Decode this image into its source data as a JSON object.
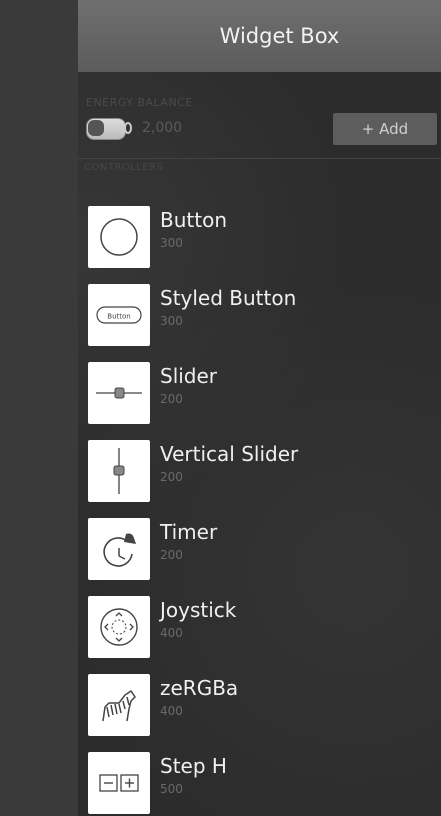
{
  "header": {
    "title": "Widget Box"
  },
  "energy": {
    "caption": "ENERGY BALANCE",
    "amount": "2,000",
    "add_label": "+ Add"
  },
  "widgets_caption": "CONTROLLERS",
  "items": [
    {
      "name": "Button",
      "price": "300",
      "icon": "circle-icon"
    },
    {
      "name": "Styled Button",
      "price": "300",
      "icon": "styled-button-icon"
    },
    {
      "name": "Slider",
      "price": "200",
      "icon": "slider-icon"
    },
    {
      "name": "Vertical Slider",
      "price": "200",
      "icon": "vertical-slider-icon"
    },
    {
      "name": "Timer",
      "price": "200",
      "icon": "timer-icon"
    },
    {
      "name": "Joystick",
      "price": "400",
      "icon": "joystick-icon"
    },
    {
      "name": "zeRGBa",
      "price": "400",
      "icon": "zebra-icon"
    },
    {
      "name": "Step H",
      "price": "500",
      "icon": "step-h-icon"
    }
  ]
}
